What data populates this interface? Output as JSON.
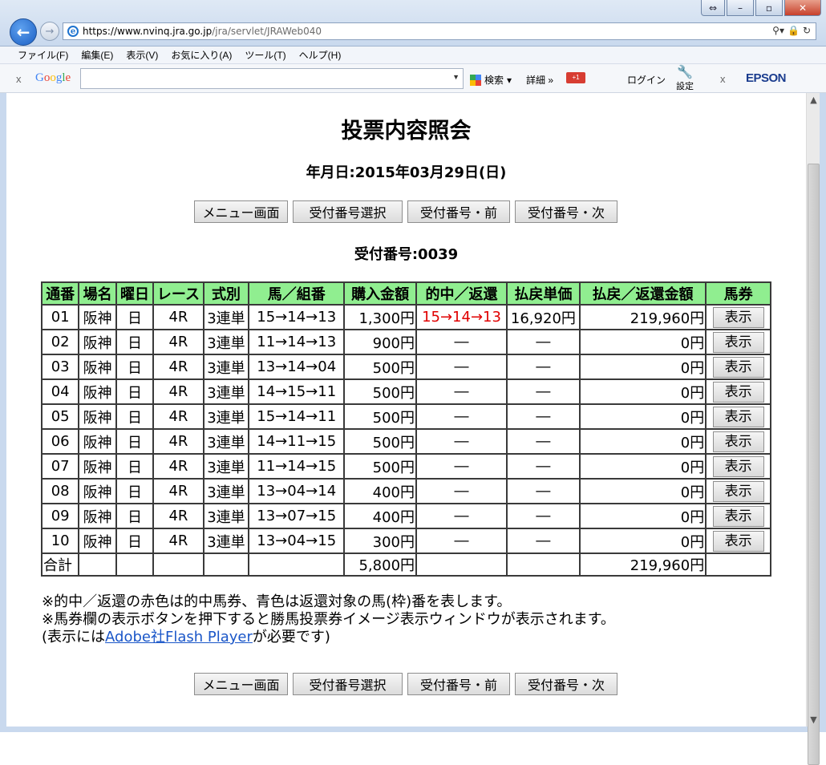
{
  "browser": {
    "url_host": "https://www.nvinq.jra.go.jp",
    "url_path": "/jra/servlet/JRAWeb040",
    "menu": [
      "ファイル(F)",
      "編集(E)",
      "表示(V)",
      "お気に入り(A)",
      "ツール(T)",
      "ヘルプ(H)"
    ],
    "google": {
      "logo": "Google",
      "search_label": "検索",
      "detail_label": "詳細",
      "plus_label": "+1",
      "login_label": "ログイン",
      "settings_label": "設定"
    },
    "epson_label": "EPSON"
  },
  "page": {
    "title": "投票内容照会",
    "date_line": "年月日:2015年03月29日(日)",
    "receipt_line": "受付番号:0039",
    "buttons": {
      "menu": "メニュー画面",
      "select": "受付番号選択",
      "prev": "受付番号・前",
      "next": "受付番号・次"
    }
  },
  "table": {
    "headers": [
      "通番",
      "場名",
      "曜日",
      "レース",
      "式別",
      "馬／組番",
      "購入金額",
      "的中／返還",
      "払戻単価",
      "払戻／返還金額",
      "馬券"
    ],
    "rows": [
      {
        "no": "01",
        "venue": "阪神",
        "day": "日",
        "race": "4R",
        "type": "3連単",
        "combo": "15→14→13",
        "amount": "1,300円",
        "hit": "15→14→13",
        "unit": "16,920円",
        "payout": "219,960円",
        "ticket": "表示"
      },
      {
        "no": "02",
        "venue": "阪神",
        "day": "日",
        "race": "4R",
        "type": "3連単",
        "combo": "11→14→13",
        "amount": "900円",
        "hit": "―",
        "unit": "―",
        "payout": "0円",
        "ticket": "表示"
      },
      {
        "no": "03",
        "venue": "阪神",
        "day": "日",
        "race": "4R",
        "type": "3連単",
        "combo": "13→14→04",
        "amount": "500円",
        "hit": "―",
        "unit": "―",
        "payout": "0円",
        "ticket": "表示"
      },
      {
        "no": "04",
        "venue": "阪神",
        "day": "日",
        "race": "4R",
        "type": "3連単",
        "combo": "14→15→11",
        "amount": "500円",
        "hit": "―",
        "unit": "―",
        "payout": "0円",
        "ticket": "表示"
      },
      {
        "no": "05",
        "venue": "阪神",
        "day": "日",
        "race": "4R",
        "type": "3連単",
        "combo": "15→14→11",
        "amount": "500円",
        "hit": "―",
        "unit": "―",
        "payout": "0円",
        "ticket": "表示"
      },
      {
        "no": "06",
        "venue": "阪神",
        "day": "日",
        "race": "4R",
        "type": "3連単",
        "combo": "14→11→15",
        "amount": "500円",
        "hit": "―",
        "unit": "―",
        "payout": "0円",
        "ticket": "表示"
      },
      {
        "no": "07",
        "venue": "阪神",
        "day": "日",
        "race": "4R",
        "type": "3連単",
        "combo": "11→14→15",
        "amount": "500円",
        "hit": "―",
        "unit": "―",
        "payout": "0円",
        "ticket": "表示"
      },
      {
        "no": "08",
        "venue": "阪神",
        "day": "日",
        "race": "4R",
        "type": "3連単",
        "combo": "13→04→14",
        "amount": "400円",
        "hit": "―",
        "unit": "―",
        "payout": "0円",
        "ticket": "表示"
      },
      {
        "no": "09",
        "venue": "阪神",
        "day": "日",
        "race": "4R",
        "type": "3連単",
        "combo": "13→07→15",
        "amount": "400円",
        "hit": "―",
        "unit": "―",
        "payout": "0円",
        "ticket": "表示"
      },
      {
        "no": "10",
        "venue": "阪神",
        "day": "日",
        "race": "4R",
        "type": "3連単",
        "combo": "13→04→15",
        "amount": "300円",
        "hit": "―",
        "unit": "―",
        "payout": "0円",
        "ticket": "表示"
      }
    ],
    "total": {
      "label": "合計",
      "amount": "5,800円",
      "payout": "219,960円"
    }
  },
  "notes": {
    "line1": "※的中／返還の赤色は的中馬券、青色は返還対象の馬(枠)番を表します。",
    "line2": "※馬券欄の表示ボタンを押下すると勝馬投票券イメージ表示ウィンドウが表示されます。",
    "line3_pre": "(表示には",
    "line3_link": "Adobe社Flash Player",
    "line3_post": "が必要です)"
  },
  "colors": {
    "header_bg": "#90ee90",
    "hit_text": "#e00000",
    "link": "#1a56c8"
  }
}
